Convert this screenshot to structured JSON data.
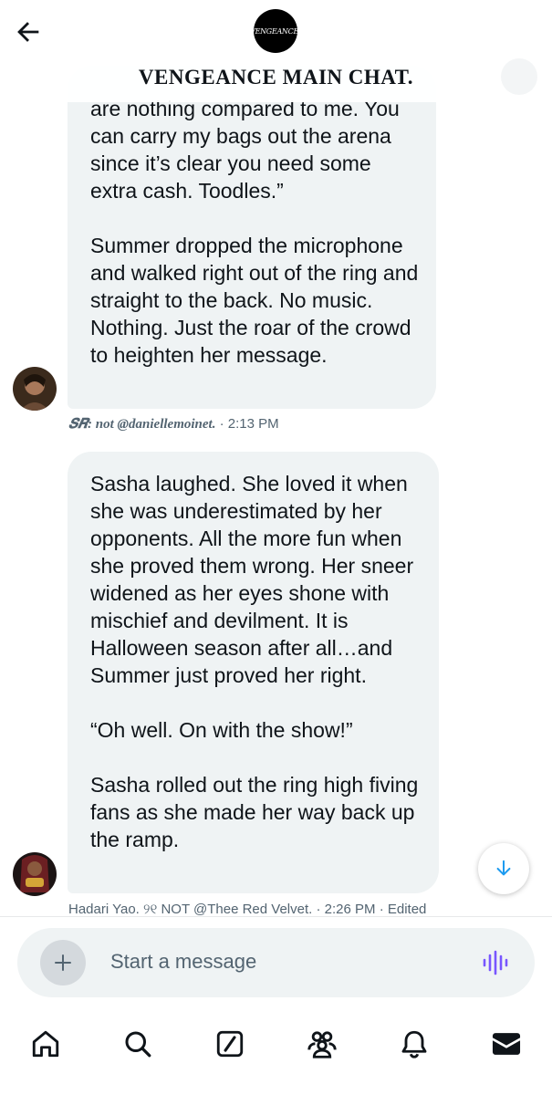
{
  "header": {
    "title": "VENGEANCE MAIN CHAT.",
    "logo_text": "VENGEANCE!",
    "back_icon": "arrow-left-icon"
  },
  "messages": [
    {
      "paragraphs": [
        "are nothing compared to me. You can carry my bags out the arena since it’s clear you need some extra cash. Toodles.”",
        "Summer dropped the microphone and walked right out of the ring and straight to the back. No music. Nothing. Just the roar of the crowd to heighten her message."
      ],
      "sender_name": "𝑺𝑹: not @daniellemoinet.",
      "time": "· 2:13 PM",
      "edited": ""
    },
    {
      "paragraphs": [
        "Sasha laughed. She loved it when she was underestimated by her opponents. All the more fun when she proved them wrong. Her sneer widened as her eyes shone with mischief and devilment. It is Halloween season after all…and Summer just proved her right.",
        "“Oh well. On with the show!”",
        "Sasha rolled out the ring high fiving fans as she made her way back up the ramp."
      ],
      "sender_name": "Hadari Yao. ୨୧ NOT @Thee Red Velvet.",
      "time": "· 2:26 PM",
      "edited": "· Edited"
    }
  ],
  "composer": {
    "placeholder": "Start a message",
    "add_icon": "plus-icon",
    "voice_icon": "voice-waveform-icon"
  },
  "tabs": [
    {
      "name": "home",
      "icon": "home-icon"
    },
    {
      "name": "search",
      "icon": "search-icon"
    },
    {
      "name": "grok",
      "icon": "grok-icon"
    },
    {
      "name": "communities",
      "icon": "communities-icon"
    },
    {
      "name": "notifications",
      "icon": "bell-icon"
    },
    {
      "name": "messages",
      "icon": "mail-icon"
    }
  ],
  "colors": {
    "bubble": "#eff3f4",
    "meta_text": "#536471",
    "accent": "#1d9bf0",
    "voice": "#7856ff"
  }
}
